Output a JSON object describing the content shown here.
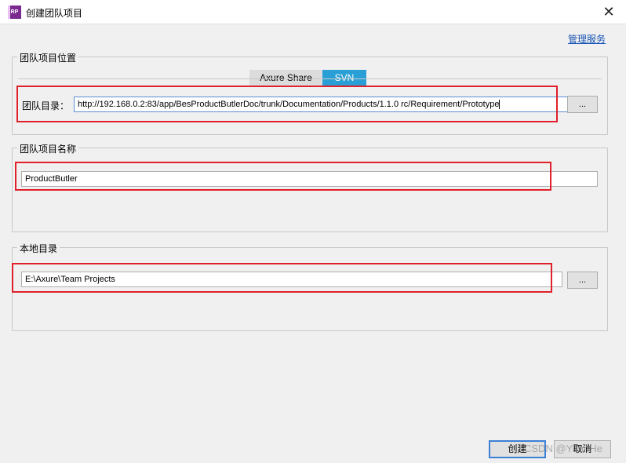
{
  "window": {
    "title": "创建团队项目",
    "app_icon_text": "RP",
    "close_glyph": "✕"
  },
  "manage_link": "管理服务",
  "team_location": {
    "legend": "团队项目位置",
    "tabs": [
      {
        "label": "Axure Share",
        "active": false
      },
      {
        "label": "SVN",
        "active": true
      }
    ],
    "dir_label": "团队目录：",
    "dir_value": "http://192.168.0.2:83/app/BesProductButlerDoc/trunk/Documentation/Products/1.1.0 rc/Requirement/Prototype",
    "browse_label": "..."
  },
  "team_name": {
    "legend": "团队项目名称",
    "value": "ProductButler"
  },
  "local_dir": {
    "legend": "本地目录",
    "value": "E:\\Axure\\Team Projects",
    "browse_label": "..."
  },
  "buttons": {
    "create": "创建",
    "cancel": "取消"
  },
  "watermark": "CSDN @YuanHe",
  "colors": {
    "accent": "#2a9fd6",
    "highlight": "#e0202a",
    "link": "#1a55b5"
  }
}
